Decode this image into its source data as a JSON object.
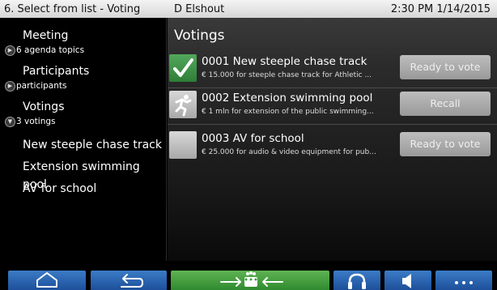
{
  "titlebar": {
    "screen": "6. Select from list - Voting",
    "user": "D Elshout",
    "datetime": "2:30 PM 1/14/2015"
  },
  "sidebar": {
    "sections": [
      {
        "label": "Meeting",
        "sub": "6 agenda topics",
        "expander": "collapsed"
      },
      {
        "label": "Participants",
        "sub": "participants",
        "expander": "collapsed"
      },
      {
        "label": "Votings",
        "sub": "3 votings",
        "expander": "expanded"
      }
    ],
    "items": [
      {
        "label": "New steeple chase track"
      },
      {
        "label": "Extension swimming pool"
      },
      {
        "label": "AV for school"
      }
    ]
  },
  "main": {
    "title": "Votings",
    "votings": [
      {
        "title": "0001  New steeple chase track",
        "desc": "€ 15.000 for steeple chase track for Athletic ...",
        "button": "Ready to vote",
        "icon": "checkmark-icon"
      },
      {
        "title": "0002  Extension swimming pool",
        "desc": "€ 1 mln for extension of the public swimming...",
        "button": "Recall",
        "icon": "running-person-icon"
      },
      {
        "title": "0003  AV for school",
        "desc": "€ 25.000 for audio & video equipment for pub...",
        "button": "Ready to vote",
        "icon": "blank-icon"
      }
    ]
  },
  "bottombar": {
    "buttons": [
      "home-icon",
      "back-icon",
      "meeting-flow-icon",
      "headphones-icon",
      "speaker-icon",
      "more-icon"
    ]
  },
  "colors": {
    "accent_blue": "#2a64b0",
    "accent_green": "#3e9a3c",
    "titlebar_bg": "#e4e4e4"
  }
}
